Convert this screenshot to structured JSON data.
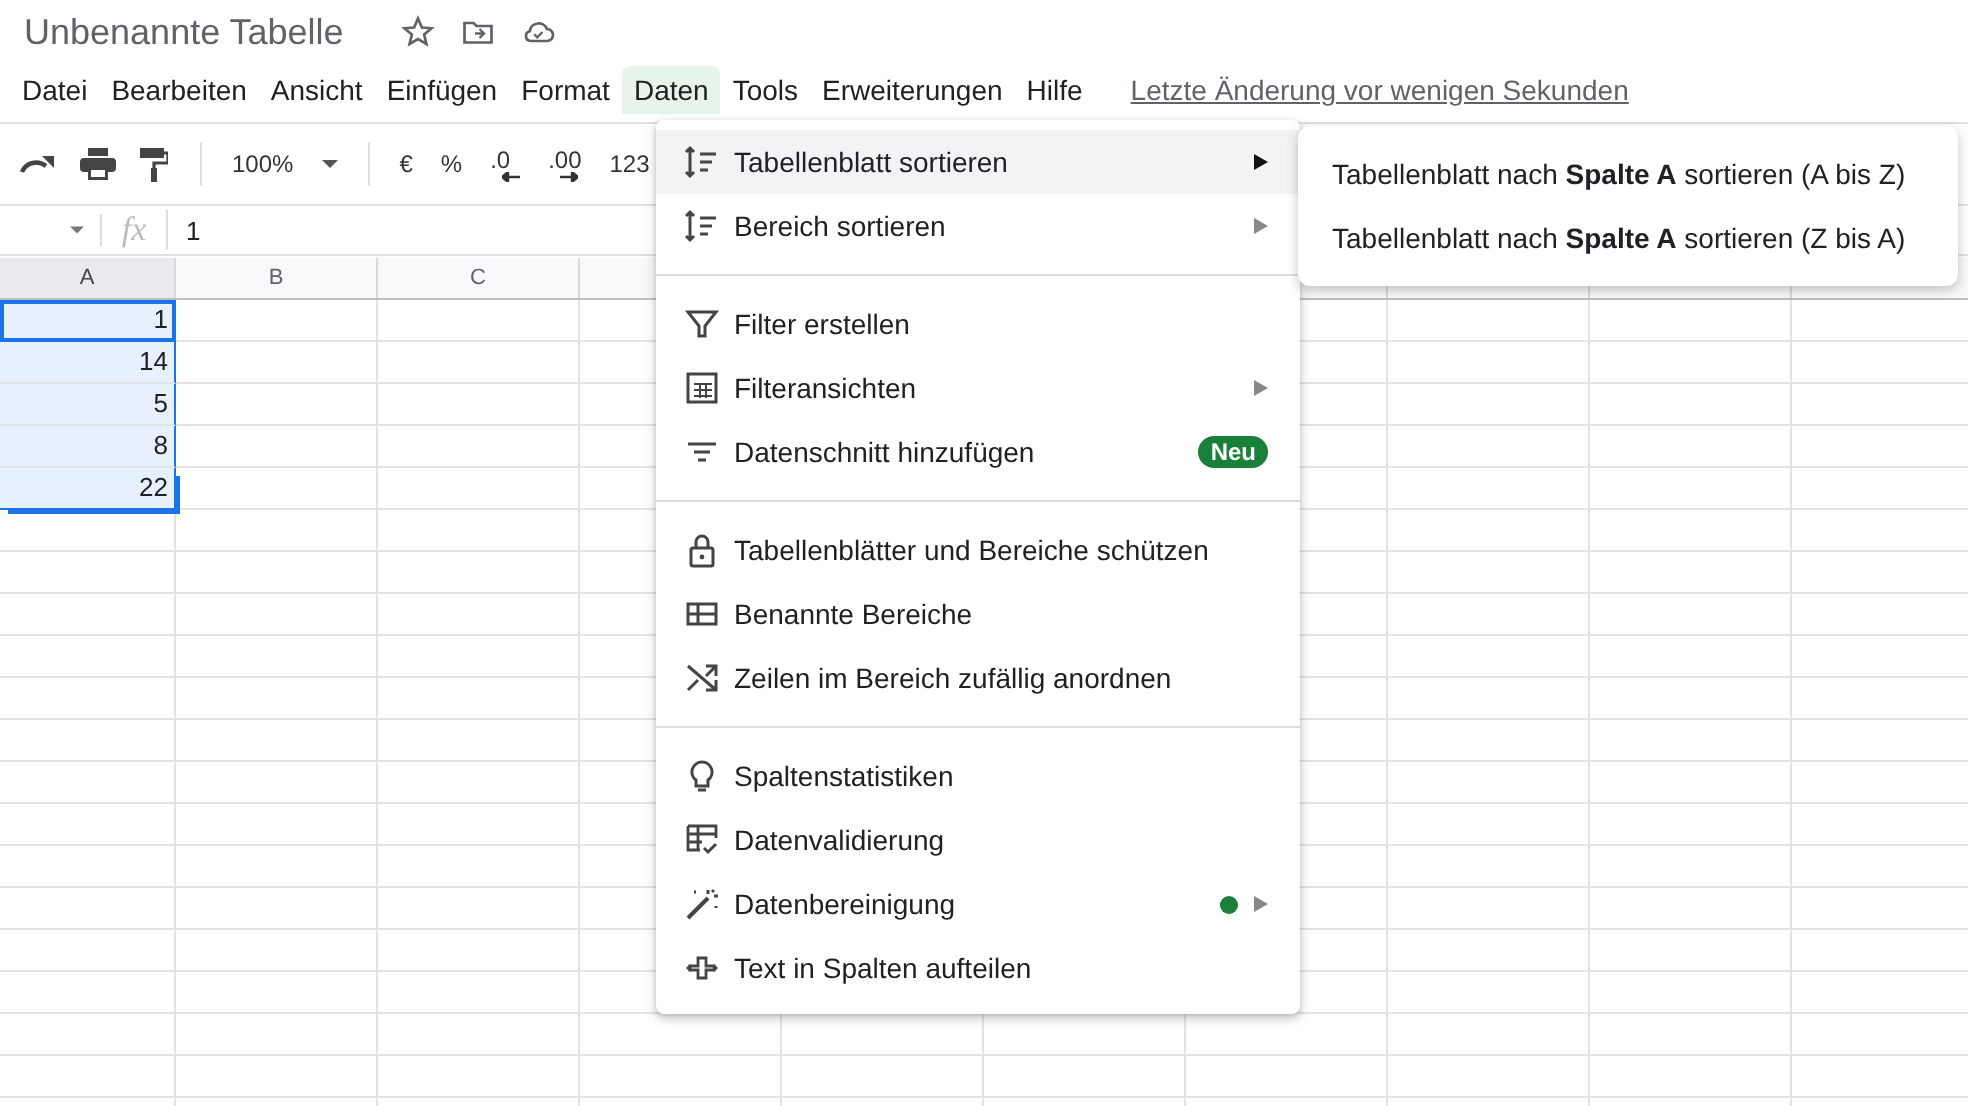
{
  "document": {
    "title": "Unbenannte Tabelle"
  },
  "menubar": {
    "items": [
      {
        "label": "Datei",
        "selected": false
      },
      {
        "label": "Bearbeiten",
        "selected": false
      },
      {
        "label": "Ansicht",
        "selected": false
      },
      {
        "label": "Einfügen",
        "selected": false
      },
      {
        "label": "Format",
        "selected": false
      },
      {
        "label": "Daten",
        "selected": true
      },
      {
        "label": "Tools",
        "selected": false
      },
      {
        "label": "Erweiterungen",
        "selected": false
      },
      {
        "label": "Hilfe",
        "selected": false
      }
    ],
    "last_edit": "Letzte Änderung vor wenigen Sekunden"
  },
  "toolbar": {
    "zoom": "100%",
    "currency": "€",
    "percent": "%",
    "decrease_decimals": ".0",
    "increase_decimals": ".00",
    "number_format": "123"
  },
  "formula_bar": {
    "fx": "fx",
    "value": "1"
  },
  "sheet": {
    "columns": [
      "A",
      "B",
      "C"
    ],
    "rows": [
      {
        "value": "1",
        "selected": true,
        "active": true
      },
      {
        "value": "14",
        "selected": true,
        "active": false
      },
      {
        "value": "5",
        "selected": true,
        "active": false
      },
      {
        "value": "8",
        "selected": true,
        "active": false
      },
      {
        "value": "22",
        "selected": true,
        "active": false
      }
    ]
  },
  "data_menu": {
    "groups": [
      [
        {
          "label": "Tabellenblatt sortieren",
          "highlighted": true,
          "submenu": true
        },
        {
          "label": "Bereich sortieren",
          "highlighted": false,
          "submenu": true
        }
      ],
      [
        {
          "label": "Filter erstellen",
          "highlighted": false,
          "submenu": false
        },
        {
          "label": "Filteransichten",
          "highlighted": false,
          "submenu": true
        },
        {
          "label": "Datenschnitt hinzufügen",
          "highlighted": false,
          "submenu": false,
          "badge": "Neu"
        }
      ],
      [
        {
          "label": "Tabellenblätter und Bereiche schützen",
          "highlighted": false,
          "submenu": false
        },
        {
          "label": "Benannte Bereiche",
          "highlighted": false,
          "submenu": false
        },
        {
          "label": "Zeilen im Bereich zufällig anordnen",
          "highlighted": false,
          "submenu": false
        }
      ],
      [
        {
          "label": "Spaltenstatistiken",
          "highlighted": false,
          "submenu": false
        },
        {
          "label": "Datenvalidierung",
          "highlighted": false,
          "submenu": false
        },
        {
          "label": "Datenbereinigung",
          "highlighted": false,
          "submenu": true,
          "color": "#188038"
        },
        {
          "label": "Text in Spalten aufteilen",
          "highlighted": false,
          "submenu": false
        }
      ]
    ]
  },
  "sort_submenu": {
    "items": [
      {
        "label": "Tabellenblatt nach **Spalte A** sortieren (A bis Z)"
      },
      {
        "label": "Tabellenblatt nach **Spalte A** sortieren (Z bis A)"
      }
    ]
  }
}
